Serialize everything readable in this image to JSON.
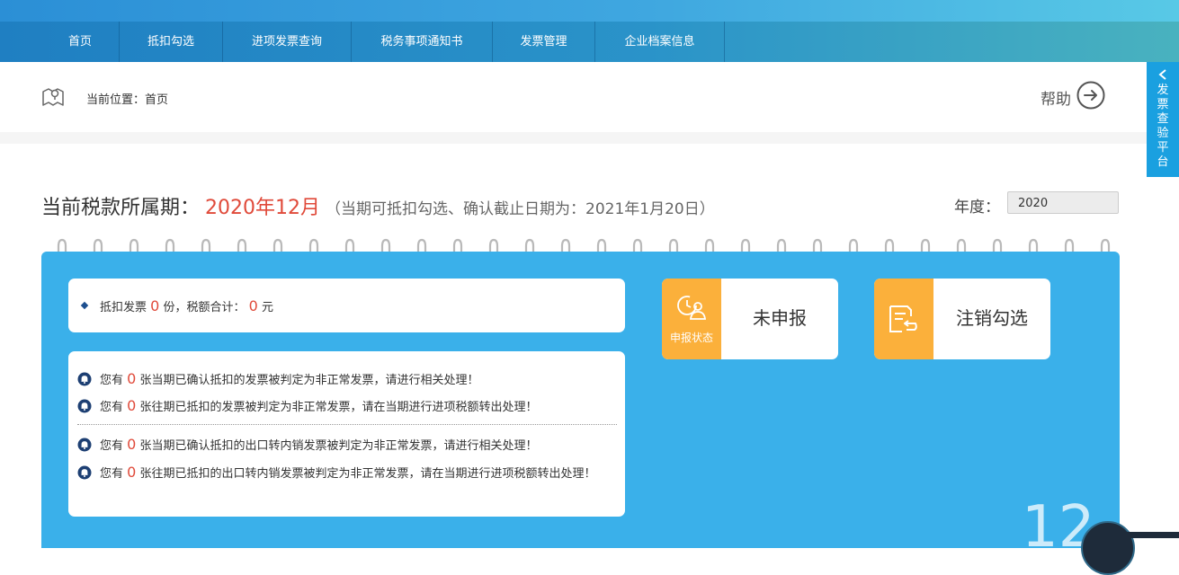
{
  "nav": {
    "items": [
      {
        "label": "首页"
      },
      {
        "label": "抵扣勾选"
      },
      {
        "label": "进项发票查询"
      },
      {
        "label": "税务事项通知书"
      },
      {
        "label": "发票管理"
      },
      {
        "label": "企业档案信息"
      }
    ]
  },
  "breadcrumb": {
    "text": "当前位置：首页"
  },
  "help": {
    "label": "帮助"
  },
  "side_tab": {
    "label": "发票查验平台"
  },
  "period": {
    "label": "当前税款所属期：",
    "value": "2020年12月",
    "note": "（当期可抵扣勾选、确认截止日期为：2021年1月20日）"
  },
  "year": {
    "label": "年度：",
    "value": "2020"
  },
  "summary": {
    "prefix": "抵扣发票",
    "count": "0",
    "middle": "份，税额合计：",
    "amount": "0",
    "suffix": "元"
  },
  "notices": [
    {
      "pre": "您有",
      "count": "0",
      "text": "张当期已确认抵扣的发票被判定为非正常发票，请进行相关处理！"
    },
    {
      "pre": "您有",
      "count": "0",
      "text": "张往期已抵扣的发票被判定为非正常发票，请在当期进行进项税额转出处理！"
    },
    {
      "pre": "您有",
      "count": "0",
      "text": "张当期已确认抵扣的出口转内销发票被判定为非正常发票，请进行相关处理！"
    },
    {
      "pre": "您有",
      "count": "0",
      "text": "张往期已抵扣的出口转内销发票被判定为非正常发票，请在当期进行进项税额转出处理！"
    }
  ],
  "status_card": {
    "sub_label": "申报状态",
    "label": "未申报"
  },
  "cancel_card": {
    "label": "注销勾选"
  },
  "calendar": {
    "month_number": "12"
  },
  "colors": {
    "accent_blue": "#3ab0ea",
    "orange": "#fbb03b",
    "red": "#e04a3a"
  }
}
